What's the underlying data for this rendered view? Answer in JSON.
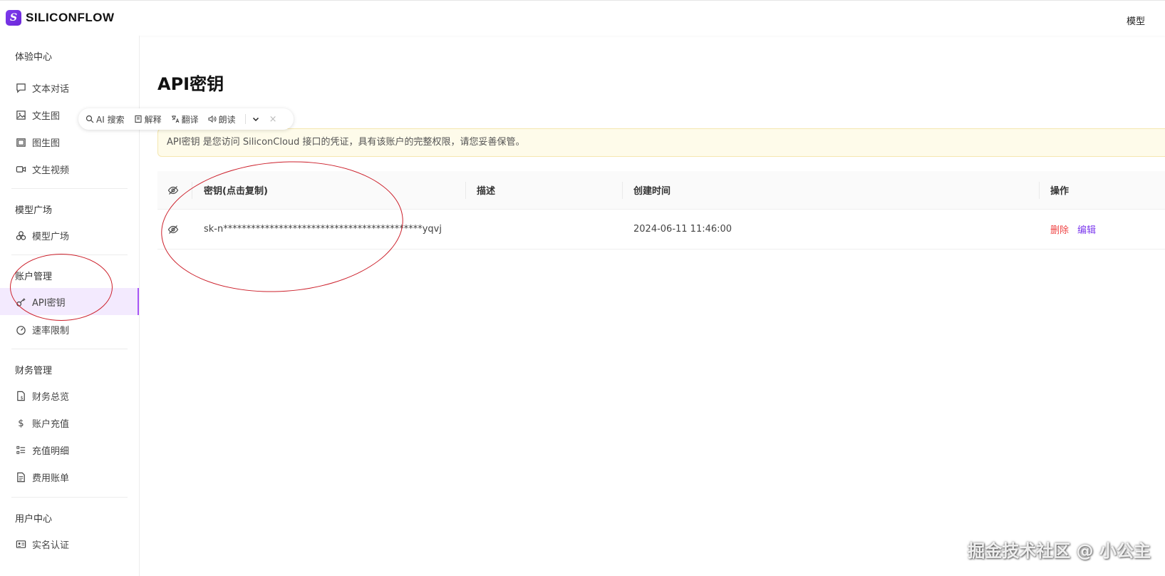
{
  "brand": {
    "logo_glyph": "S",
    "name": "SILICONFLOW"
  },
  "top_nav": {
    "models": "模型"
  },
  "sidebar": {
    "sections": [
      {
        "title": "体验中心",
        "items": [
          {
            "label": "文本对话",
            "icon": "chat-icon"
          },
          {
            "label": "文生图",
            "icon": "image-icon"
          },
          {
            "label": "图生图",
            "icon": "images-icon"
          },
          {
            "label": "文生视频",
            "icon": "video-icon"
          }
        ]
      },
      {
        "title": "模型广场",
        "items": [
          {
            "label": "模型广场",
            "icon": "cluster-icon"
          }
        ]
      },
      {
        "title": "账户管理",
        "items": [
          {
            "label": "API密钥",
            "icon": "key-icon",
            "active": true
          },
          {
            "label": "速率限制",
            "icon": "speedometer-icon"
          }
        ]
      },
      {
        "title": "财务管理",
        "items": [
          {
            "label": "财务总览",
            "icon": "document-dollar-icon"
          },
          {
            "label": "账户充值",
            "icon": "dollar-icon"
          },
          {
            "label": "充值明细",
            "icon": "list-icon"
          },
          {
            "label": "费用账单",
            "icon": "receipt-icon"
          }
        ]
      },
      {
        "title": "用户中心",
        "items": [
          {
            "label": "实名认证",
            "icon": "id-card-icon"
          }
        ]
      }
    ]
  },
  "main": {
    "title": "API密钥",
    "notice": "API密钥 是您访问 SiliconCloud 接口的凭证，具有该账户的完整权限，请您妥善保管。",
    "table": {
      "columns": [
        "密钥(点击复制)",
        "描述",
        "创建时间",
        "操作"
      ],
      "rows": [
        {
          "key": "sk-n*******************************************yqvj",
          "description": "",
          "created": "2024-06-11 11:46:00",
          "actions": {
            "delete": "删除",
            "edit": "编辑"
          }
        }
      ]
    }
  },
  "floating_toolbar": {
    "ai_search": "AI 搜索",
    "explain": "解释",
    "translate": "翻译",
    "read": "朗读",
    "close": "×"
  },
  "watermark": "掘金技术社区 @ 小公主",
  "colors": {
    "accent": "#7c3aed",
    "active_bg": "#f3eafe",
    "notice_bg": "#fefbea",
    "delete": "#ef4444",
    "annotation": "#cc1f2a"
  }
}
